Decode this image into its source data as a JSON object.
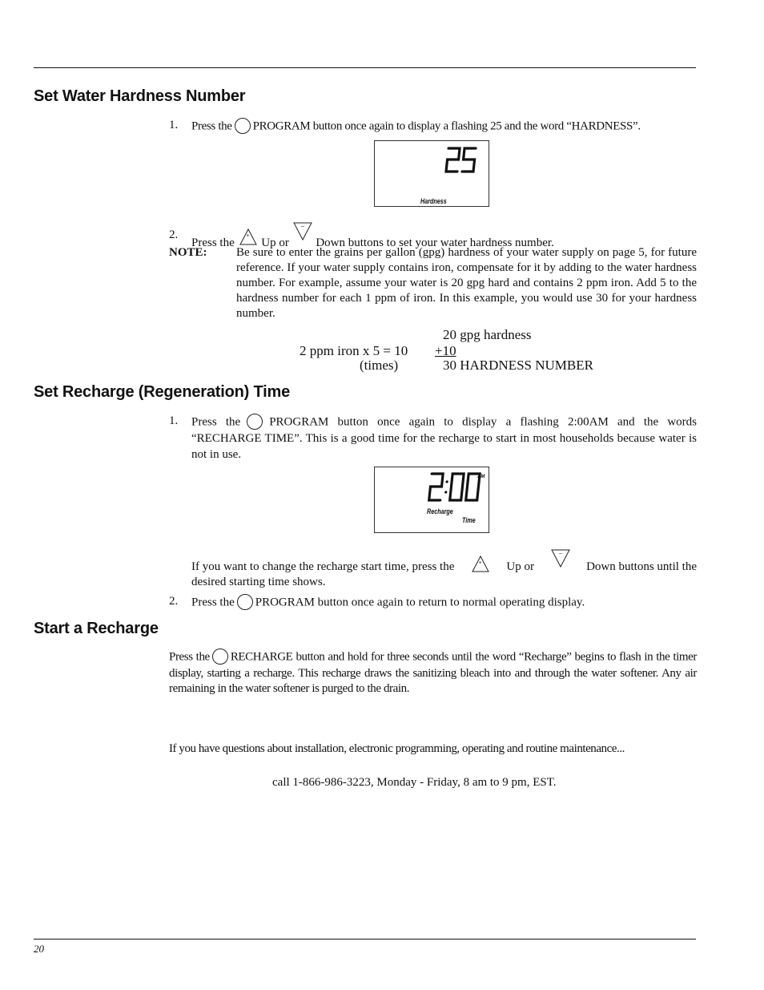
{
  "sections": {
    "hardness": {
      "heading": "Set Water Hardness Number",
      "step1": {
        "num": "1.",
        "pre": "Press the",
        "post": "PROGRAM button once again to display a flashing 25 and the word “HARDNESS”."
      },
      "display": {
        "digits": "25",
        "label": "Hardness"
      },
      "step2": {
        "num": "2.",
        "pre": "Press the",
        "mid": "Up or",
        "post": "Down buttons to set your water hardness number."
      },
      "note": {
        "label": "NOTE:",
        "text": "Be sure to enter the grains per gallon (gpg) hardness of your water supply on page 5, for future reference.  If your water supply contains iron, compensate for it by adding to the water hardness number. For example, assume your water is 20 gpg hard and contains 2 ppm iron. Add 5 to the hardness number for each 1 ppm of iron. In this example, you would use 30 for your hardness number."
      },
      "calc": {
        "line1": "20 gpg hardness",
        "left": "2 ppm iron x 5 = 10",
        "plus": "+10",
        "times": "(times)",
        "result": "30 HARDNESS NUMBER"
      }
    },
    "recharge_time": {
      "heading": "Set Recharge (Regeneration) Time",
      "step1": {
        "num": "1.",
        "pre": "Press the",
        "post": "PROGRAM button once again to display a flashing 2:00AM and the words “RECHARGE TIME”. This is a good time for the recharge to start in most households because water is not in use."
      },
      "display": {
        "digits": "2:00",
        "ampm": "AM",
        "label1": "Recharge",
        "label2": "Time"
      },
      "change": {
        "pre": "If you want to change the recharge start time, press the",
        "mid": "Up or",
        "post": "Down buttons until the desired starting time shows."
      },
      "step2": {
        "num": "2.",
        "pre": "Press the",
        "post": "PROGRAM button once again to return to normal operating display."
      }
    },
    "start_recharge": {
      "heading": "Start a Recharge",
      "pre": "Press the",
      "post": "RECHARGE button and hold for three seconds until the word “Recharge” begins to flash in the timer display, starting a recharge. This recharge draws the sanitizing bleach into and through the water softener. Any air remaining in the water softener is purged to the drain."
    }
  },
  "contact": {
    "question": "If you have questions about installation, electronic programming, operating and routine maintenance...",
    "call": "call 1-866-986-3223, Monday - Friday, 8 am to 9 pm, EST."
  },
  "footer": {
    "page_number": "20"
  },
  "icons": {
    "program_button": "circle-button-icon",
    "up_button": "up-triangle-plus-icon",
    "down_button": "down-triangle-minus-icon",
    "recharge_button": "circle-button-icon"
  }
}
